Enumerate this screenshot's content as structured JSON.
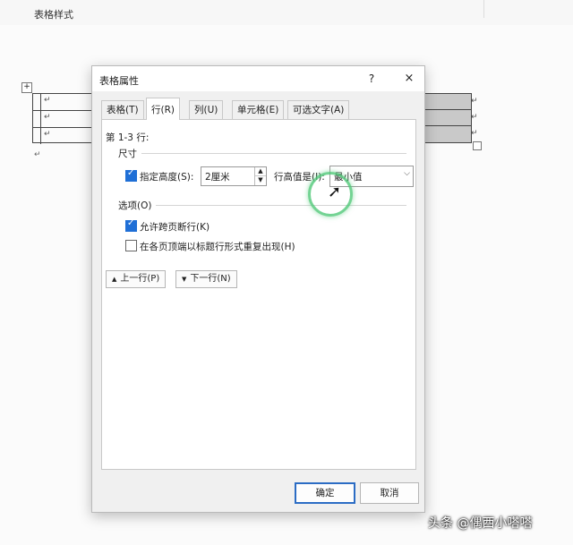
{
  "ribbon": {
    "label": "表格样式"
  },
  "doc": {
    "cell_mark": "↵",
    "para_mark": "↵",
    "move_handle": "+"
  },
  "dialog": {
    "title": "表格属性",
    "help": "?",
    "close": "×",
    "tabs": [
      {
        "label": "表格(T)"
      },
      {
        "label": "行(R)"
      },
      {
        "label": "列(U)"
      },
      {
        "label": "单元格(E)"
      },
      {
        "label": "可选文字(A)"
      }
    ],
    "active_tab": "行(R)",
    "rows_label": "第 1-3 行:",
    "size_group": "尺寸",
    "specify_height": {
      "label": "指定高度(S):",
      "checked": true
    },
    "height_value": "2厘米",
    "row_height_is_label": "行高值是(I):",
    "row_height_is_value": "最小值",
    "options_group": "选项(O)",
    "allow_break": {
      "label": "允许跨页断行(K)",
      "checked": true
    },
    "repeat_header": {
      "label": "在各页顶端以标题行形式重复出现(H)",
      "checked": false
    },
    "prev_row": "上一行(P)",
    "next_row": "下一行(N)",
    "ok": "确定",
    "cancel": "取消"
  },
  "icons": {
    "help": "help-icon",
    "close": "close-icon",
    "spin_up": "chevron-up-icon",
    "spin_down": "chevron-down-icon",
    "dropdown": "chevron-down-icon",
    "prev": "triangle-up-icon",
    "next": "triangle-down-icon",
    "cursor": "mouse-pointer-icon"
  },
  "colors": {
    "accent": "#1f6fd6",
    "highlight_ring": "#50c878"
  },
  "watermark": "头条 @偶西小嗒嗒"
}
